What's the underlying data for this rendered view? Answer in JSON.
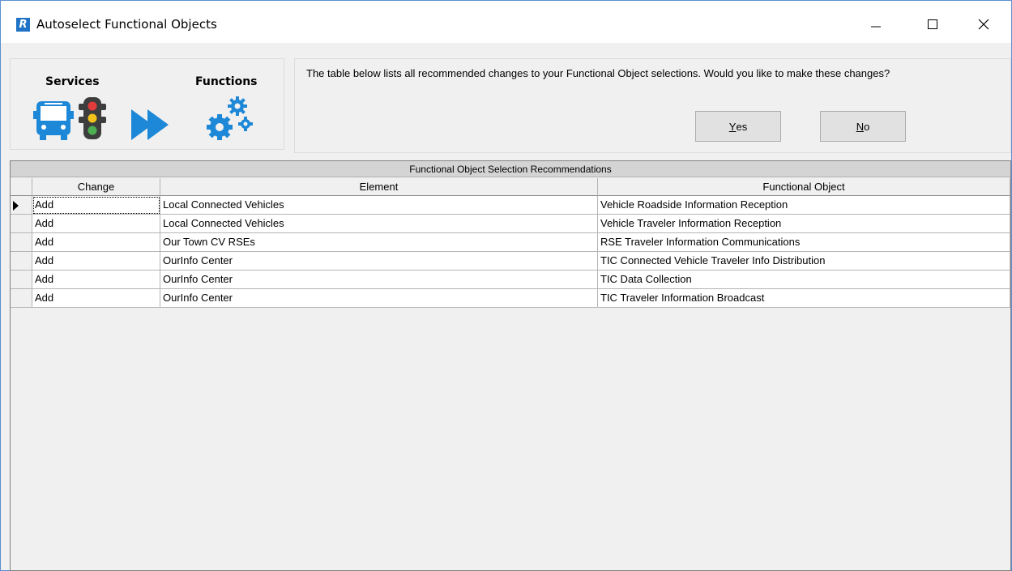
{
  "window": {
    "app_icon_letter": "R",
    "title": "Autoselect Functional Objects"
  },
  "graphic": {
    "services_label": "Services",
    "functions_label": "Functions",
    "icons": [
      "bus-icon",
      "traffic-light-icon",
      "double-arrow-icon",
      "gears-icon"
    ]
  },
  "prompt": {
    "message": "The table below lists all recommended changes to your Functional Object selections.  Would you like to make these changes?",
    "yes_prefix": "Y",
    "yes_rest": "es",
    "no_prefix": "N",
    "no_rest": "o"
  },
  "table": {
    "caption": "Functional Object Selection Recommendations",
    "columns": [
      "Change",
      "Element",
      "Functional Object"
    ],
    "rows": [
      {
        "change": "Add",
        "element": "Local Connected Vehicles",
        "functional_object": "Vehicle Roadside Information Reception"
      },
      {
        "change": "Add",
        "element": "Local Connected Vehicles",
        "functional_object": "Vehicle Traveler Information Reception"
      },
      {
        "change": "Add",
        "element": "Our Town CV RSEs",
        "functional_object": "RSE Traveler Information Communications"
      },
      {
        "change": "Add",
        "element": "OurInfo Center",
        "functional_object": "TIC Connected Vehicle Traveler Info Distribution"
      },
      {
        "change": "Add",
        "element": "OurInfo Center",
        "functional_object": "TIC Data Collection"
      },
      {
        "change": "Add",
        "element": "OurInfo Center",
        "functional_object": "TIC Traveler Information Broadcast"
      }
    ]
  },
  "colors": {
    "app_icon": "#1f73c6",
    "icon_blue": "#1e88d8",
    "traffic_red": "#e23b3b",
    "traffic_yellow": "#f2c21b",
    "traffic_green": "#4caf50"
  }
}
